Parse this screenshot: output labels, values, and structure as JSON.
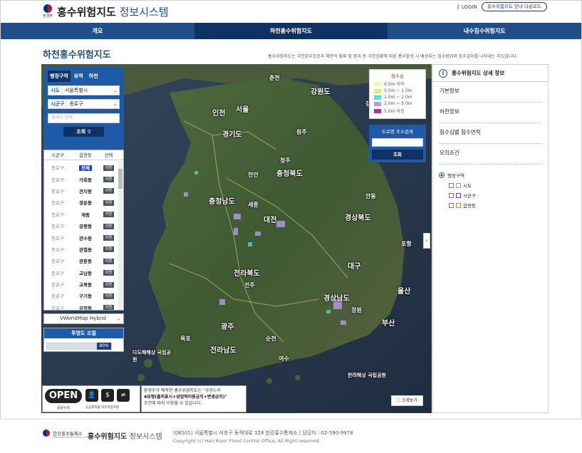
{
  "header": {
    "gov_label": "환경부",
    "title_bold": "홍수위험지도",
    "title_sub": "정보시스템",
    "login": "LOGIN",
    "manual_button": "홍수위험지도 안내 다운로드"
  },
  "nav": {
    "items": [
      "개요",
      "하천홍수위험지도",
      "내수침수위험지도"
    ],
    "active_index": 1
  },
  "page": {
    "title": "하천홍수위험지도",
    "description": "홍수위험지도는 극한강우조건과 제방의 월류 및 붕괴 등 극한상황에 따른 홍수발생 시 예상되는 침수범위와 침수깊이를 나타내는 지도입니다."
  },
  "left_panel": {
    "tabs": [
      "행정구역",
      "유역",
      "하천"
    ],
    "active_tab": 0,
    "sido_label": "시도",
    "sido_value": "서울특별시",
    "sigungu_label": "시군구",
    "sigungu_value": "종로구",
    "search_placeholder": "검색어 입력",
    "search_button": "조회",
    "table_headers": [
      "시군구",
      "읍면동",
      "선택"
    ],
    "move_label": "이동",
    "rows": [
      {
        "sigungu": "종로구",
        "dong": "전체"
      },
      {
        "sigungu": "종로구",
        "dong": "가회동"
      },
      {
        "sigungu": "종로구",
        "dong": "견지동"
      },
      {
        "sigungu": "종로구",
        "dong": "경운동"
      },
      {
        "sigungu": "종로구",
        "dong": "계동"
      },
      {
        "sigungu": "종로구",
        "dong": "공평동"
      },
      {
        "sigungu": "종로구",
        "dong": "관수동"
      },
      {
        "sigungu": "종로구",
        "dong": "관철동"
      },
      {
        "sigungu": "종로구",
        "dong": "관훈동"
      },
      {
        "sigungu": "종로구",
        "dong": "교남동"
      },
      {
        "sigungu": "종로구",
        "dong": "교북동"
      },
      {
        "sigungu": "종로구",
        "dong": "구기동"
      },
      {
        "sigungu": "종로구",
        "dong": "궁정동"
      }
    ],
    "selected_row": 0,
    "basemap": "VWorldMap Hybrid",
    "opacity_title": "투명도 조절",
    "opacity_value": "80%",
    "opacity_fraction": 0.8
  },
  "legend": {
    "title": "침수심",
    "items": [
      {
        "label": "0.5m 이하",
        "color": "#fff6b0"
      },
      {
        "label": "0.5m ~ 1.0m",
        "color": "#d6f07a"
      },
      {
        "label": "1.0m ~ 2.0m",
        "color": "#4fe0e8"
      },
      {
        "label": "2.0m ~ 5.0m",
        "color": "#b89af0"
      },
      {
        "label": "5.0m 이상",
        "color": "#c0307a"
      }
    ]
  },
  "address_search": {
    "title": "도로명 주소검색",
    "button": "조회"
  },
  "map_labels": [
    {
      "text": "강원도",
      "big": true
    },
    {
      "text": "경기도",
      "big": true
    },
    {
      "text": "서울",
      "big": true
    },
    {
      "text": "인천",
      "big": true
    },
    {
      "text": "충청북도",
      "big": true
    },
    {
      "text": "충청남도",
      "big": true
    },
    {
      "text": "세종",
      "big": false
    },
    {
      "text": "대전",
      "big": true
    },
    {
      "text": "경상북도",
      "big": true
    },
    {
      "text": "대구",
      "big": true
    },
    {
      "text": "전라북도",
      "big": true
    },
    {
      "text": "전주",
      "big": false
    },
    {
      "text": "경상남도",
      "big": true
    },
    {
      "text": "울산",
      "big": true
    },
    {
      "text": "부산",
      "big": true
    },
    {
      "text": "광주",
      "big": true
    },
    {
      "text": "전라남도",
      "big": true
    },
    {
      "text": "춘천",
      "big": false
    },
    {
      "text": "원주",
      "big": false
    },
    {
      "text": "강릉",
      "big": false
    },
    {
      "text": "천안",
      "big": false
    },
    {
      "text": "청주",
      "big": false
    },
    {
      "text": "포항",
      "big": false
    },
    {
      "text": "창원",
      "big": false
    },
    {
      "text": "순천",
      "big": false
    },
    {
      "text": "목포",
      "big": false
    },
    {
      "text": "안동",
      "big": false
    },
    {
      "text": "여수",
      "big": false
    },
    {
      "text": "다도해해상 국립공원",
      "big": false
    },
    {
      "text": "한려해상 국립공원",
      "big": false
    }
  ],
  "open_badge": {
    "open": "OPEN",
    "gongnuri": "공공누리",
    "icon_labels": "공공저작물 자유이용허락"
  },
  "license_text_1": "환경부가 제작한 홍수위험지도는 \"공공누리",
  "license_text_2": "4유형(출처표시+상업적이용금지+변경금지)\"",
  "license_text_3": "조건에 따라 이용할 수 있습니다.",
  "fullscreen_button": "크게보기",
  "right_panel": {
    "title": "홍수위험지도 상세 정보",
    "items": [
      "기본정보",
      "하천정보",
      "침수심별 침수면적",
      "모의조건"
    ],
    "layer_group": "행정구역",
    "layers": [
      "시도",
      "시군구",
      "읍면동"
    ]
  },
  "footer": {
    "org": "한강홍수통제소",
    "org_en": "Han River Flood Control Office",
    "sys_bold": "홍수위험지도",
    "sys_sub": "정보시스템",
    "address": "(06501) 서울특별시 서초구 동작대로 328 한강홍수통제소 | 담당자 : 02-590-9978",
    "copyright": "Copyright (c) Han River Flood Control Office, All Right reserved."
  }
}
